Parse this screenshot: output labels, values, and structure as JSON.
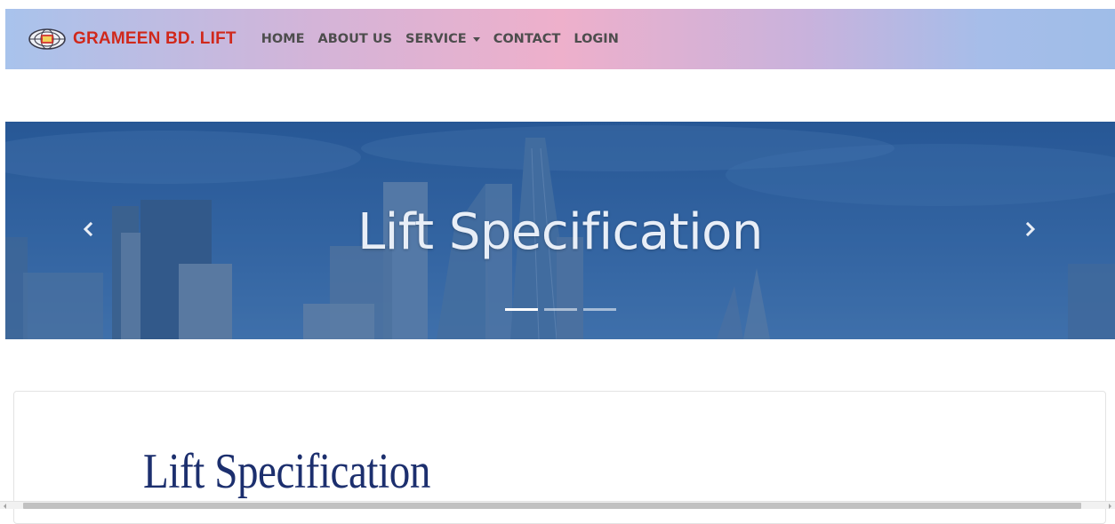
{
  "brand": {
    "name": "GRAMEEN BD. LIFT",
    "logo_icon": "globe-elevator-logo-icon",
    "color": "#d0281b"
  },
  "nav": {
    "items": [
      {
        "label": "HOME",
        "has_dropdown": false
      },
      {
        "label": "ABOUT US",
        "has_dropdown": false
      },
      {
        "label": "SERVICE",
        "has_dropdown": true
      },
      {
        "label": "CONTACT",
        "has_dropdown": false
      },
      {
        "label": "LOGIN",
        "has_dropdown": false
      }
    ],
    "text_color": "#4d4d4d"
  },
  "hero": {
    "title": "Lift Specification",
    "prev_icon": "chevron-left-icon",
    "next_icon": "chevron-right-icon",
    "slides_count": 3,
    "active_slide": 1,
    "tint_color": "#3a6ca8"
  },
  "content": {
    "heading": "Lift Specification",
    "heading_color": "#1c2f6e"
  }
}
